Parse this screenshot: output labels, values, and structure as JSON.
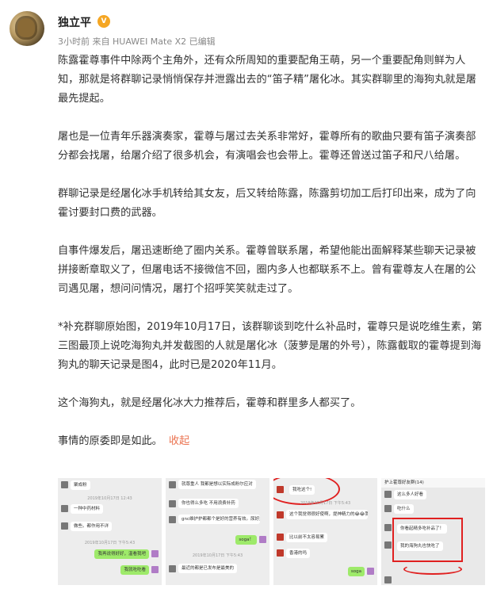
{
  "post": {
    "username": "独立平",
    "vip_badge": "V",
    "meta": "3小时前 来自 HUAWEI Mate X2 已编辑",
    "paragraphs": [
      "陈露霍尊事件中除两个主角外，还有众所周知的重要配角王萌，另一个重要配角则鲜为人知，那就是将群聊记录悄悄保存并泄露出去的“笛子精”屠化冰。其实群聊里的海狗丸就是屠最先提起。",
      "屠也是一位青年乐器演奏家，霍尊与屠过去关系非常好，霍尊所有的歌曲只要有笛子演奏部分都会找屠，给屠介绍了很多机会，有演唱会也会带上。霍尊还曾送过笛子和尺八给屠。",
      "群聊记录是经屠化冰手机转给其女友，后又转给陈露，陈露剪切加工后打印出来，成为了向霍讨要封口费的武器。",
      "自事件爆发后，屠迅速断绝了圈内关系。霍尊曾联系屠，希望他能出面解释某些聊天记录被拼接断章取义了，但屠电话不接微信不回，圈内多人也都联系不上。曾有霍尊友人在屠的公司遇见屠，想问问情况，屠打个招呼笑笑就走过了。",
      "*补充群聊原始图，2019年10月17日，该群聊谈到吃什么补品时，霍尊只是说吃维生素，第三图最顶上说吃海狗丸并发截图的人就是屠化冰（菠萝是屠的外号），陈露截取的霍尊提到海狗丸的聊天记录是图4，此时已是2020年11月。",
      "这个海狗丸，就是经屠化冰大力推荐后，霍尊和群里多人都买了。",
      "事情的原委即是如此。"
    ],
    "collapse_label": "收起"
  },
  "images": [
    {
      "messages": [
        "聚成粉",
        "一种中药材料",
        "做些。都作用不详",
        "我再说得好好，温看我吧",
        "我就吃吃看"
      ],
      "timestamps": [
        "2019年10月17日 12:43",
        "2019年10月17日 下午5:43"
      ]
    },
    {
      "messages": [
        "就尊重人 我都是想以实际成粉尔应对",
        "你也得么多吃 不用浪费补药",
        "gnc维护护都都个是好的营养有效。尿好是一直不好",
        "soga！",
        "最近的都是已发布是最美的"
      ],
      "timestamps": [
        "2019年10月17日 下午5:43"
      ]
    },
    {
      "messages": [
        "我吃这个!",
        "这个我觉得很好使啊，提神精力的😂😂我就没吸有用",
        "比以前不太容易累",
        "香港的吗",
        "soga"
      ],
      "timestamps": [
        "2019年10月17日 下午5:43"
      ]
    },
    {
      "messages": [
        "护上霍尊好友群(14)",
        "这么多人好看",
        "吃什么",
        "你看起精多吃补品了！",
        "我的海狗丸也快吃了"
      ],
      "timestamps": []
    }
  ]
}
